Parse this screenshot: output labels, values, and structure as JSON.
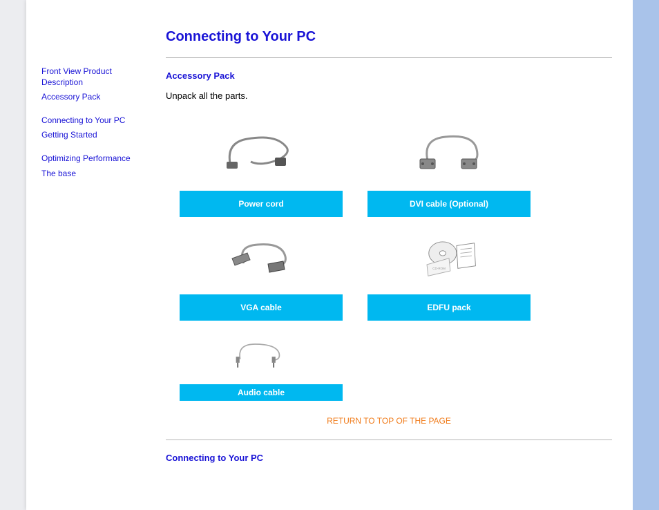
{
  "sidebar": {
    "groups": [
      {
        "items": [
          {
            "label": "Front View Product Description"
          },
          {
            "label": "Accessory Pack"
          }
        ]
      },
      {
        "items": [
          {
            "label": "Connecting to Your PC"
          },
          {
            "label": "Getting Started"
          }
        ]
      },
      {
        "items": [
          {
            "label": "Optimizing Performance"
          },
          {
            "label": "The base"
          }
        ]
      }
    ]
  },
  "page": {
    "title": "Connecting to Your PC",
    "accessory_heading": "Accessory Pack",
    "unpack_text": "Unpack all the parts.",
    "return_link": "RETURN TO TOP OF THE PAGE",
    "section2_heading": "Connecting to Your PC"
  },
  "accessories": {
    "power_cord": "Power cord",
    "dvi_cable": "DVI cable (Optional)",
    "vga_cable": "VGA cable",
    "edfu_pack": "EDFU pack",
    "audio_cable": "Audio cable"
  }
}
